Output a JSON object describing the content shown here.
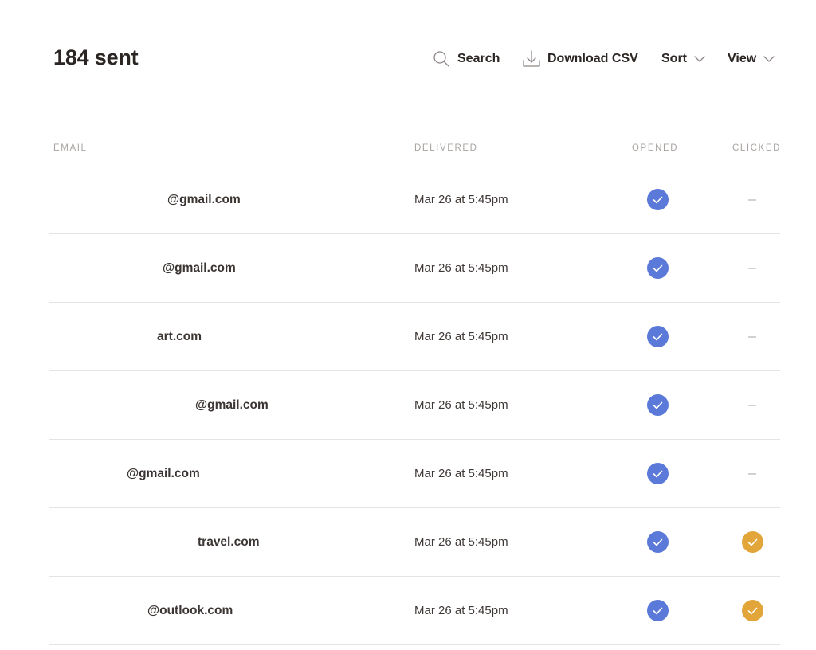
{
  "header": {
    "title": "184 sent",
    "toolbar": {
      "search_label": "Search",
      "download_label": "Download CSV",
      "sort_label": "Sort",
      "view_label": "View"
    }
  },
  "table": {
    "columns": [
      "EMAIL",
      "DELIVERED",
      "OPENED",
      "CLICKED"
    ],
    "rows": [
      {
        "email": "@gmail.com",
        "delivered": "Mar 26 at 5:45pm",
        "opened": true,
        "clicked": false
      },
      {
        "email": "@gmail.com",
        "delivered": "Mar 26 at 5:45pm",
        "opened": true,
        "clicked": false
      },
      {
        "email": "art.com",
        "delivered": "Mar 26 at 5:45pm",
        "opened": true,
        "clicked": false
      },
      {
        "email": "@gmail.com",
        "delivered": "Mar 26 at 5:45pm",
        "opened": true,
        "clicked": false
      },
      {
        "email": "@gmail.com",
        "delivered": "Mar 26 at 5:45pm",
        "opened": true,
        "clicked": false
      },
      {
        "email": "travel.com",
        "delivered": "Mar 26 at 5:45pm",
        "opened": true,
        "clicked": true
      },
      {
        "email": "@outlook.com",
        "delivered": "Mar 26 at 5:45pm",
        "opened": true,
        "clicked": true
      }
    ]
  },
  "icons": {
    "search": "search-icon",
    "download": "download-icon",
    "sort": "chevron-down-icon",
    "view": "chevron-down-icon",
    "opened": "check-circle-icon",
    "clicked": "check-circle-icon",
    "not_clicked": "dash-icon"
  },
  "colors": {
    "opened_check": "#5a79d8",
    "clicked_check": "#e2a53a",
    "text": "#2b2523",
    "muted": "#a9a4a2",
    "divider": "#e6e3e2"
  }
}
